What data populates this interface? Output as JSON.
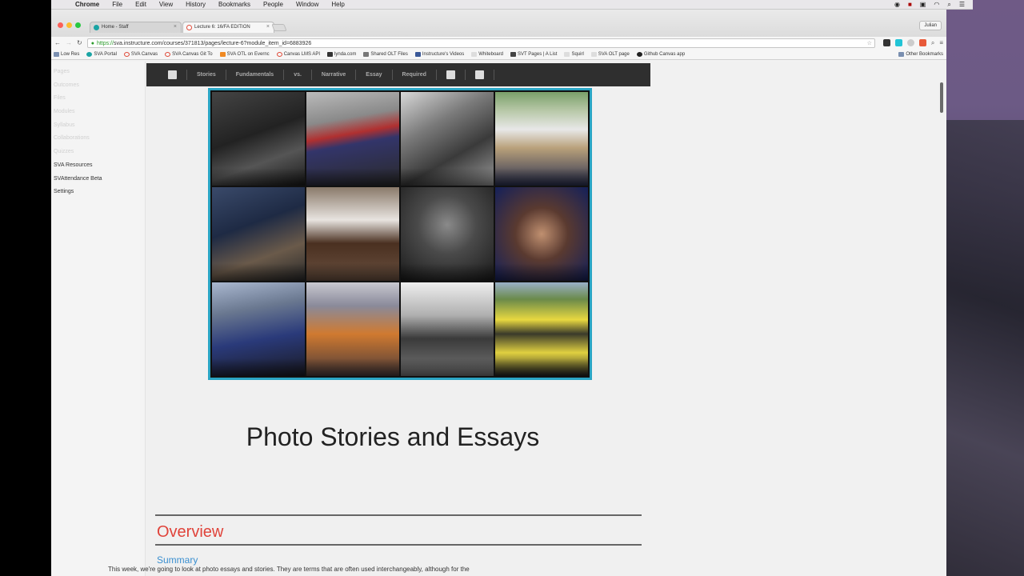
{
  "menubar": {
    "items": [
      "Chrome",
      "File",
      "Edit",
      "View",
      "History",
      "Bookmarks",
      "People",
      "Window",
      "Help"
    ]
  },
  "tabs": [
    {
      "label": "Home - Staff",
      "color": "#1aa4a4"
    },
    {
      "label": "Lecture 6: 16/FA EDITION",
      "color": "#e04b3a"
    }
  ],
  "user_button": "Julian",
  "toolbar": {
    "url_scheme": "https://",
    "url_rest": "sva.instructure.com/courses/371813/pages/lecture-6?module_item_id=6883926"
  },
  "bookmarks": [
    {
      "label": "Low Res",
      "color": "#7a8fb0"
    },
    {
      "label": "SVA Portal",
      "color": "#1aa4a4"
    },
    {
      "label": "SVA Canvas",
      "color": "#e04b3a"
    },
    {
      "label": "SVA Canvas Git To",
      "color": "#e04b3a"
    },
    {
      "label": "SVA OTL on Evernc",
      "color": "#f08a24"
    },
    {
      "label": "Canvas LMS API",
      "color": "#e04b3a"
    },
    {
      "label": "lynda.com",
      "color": "#333333"
    },
    {
      "label": "Shared OLT Files",
      "color": "#777777"
    },
    {
      "label": "Instructure's Videos",
      "color": "#3b5998"
    },
    {
      "label": "Whiteboard",
      "color": "#aaaaaa"
    },
    {
      "label": "SVT Pages | A List",
      "color": "#444444"
    },
    {
      "label": "Squirl",
      "color": "#aaaaaa"
    },
    {
      "label": "SVA OLT page",
      "color": "#aaaaaa"
    },
    {
      "label": "Github Canvas app",
      "color": "#222222"
    }
  ],
  "bookmarks_other": "Other Bookmarks",
  "leftnav": [
    {
      "label": "Pages",
      "dark": false
    },
    {
      "label": "Outcomes",
      "dark": false
    },
    {
      "label": "Files",
      "dark": false
    },
    {
      "label": "Modules",
      "dark": false
    },
    {
      "label": "Syllabus",
      "dark": false
    },
    {
      "label": "Collaborations",
      "dark": false
    },
    {
      "label": "Quizzes",
      "dark": false
    },
    {
      "label": "SVA Resources",
      "dark": true
    },
    {
      "label": "SVAttendance Beta",
      "dark": true
    },
    {
      "label": "Settings",
      "dark": true
    }
  ],
  "photonav": [
    "Stories",
    "Fundamentals",
    "vs.",
    "Narrative",
    "Essay",
    "Required"
  ],
  "page_title": "Photo Stories and Essays",
  "overview": "Overview",
  "summary": "Summary",
  "paragraph": "This week, we're going to look at photo essays and stories. They are terms that are often used interchangeably, although for the",
  "colors": {
    "overview_red": "#e0433a",
    "summary_blue": "#3a8fd0",
    "grid_border": "#2aa5c4",
    "nav_dark": "#2f2f2f"
  }
}
